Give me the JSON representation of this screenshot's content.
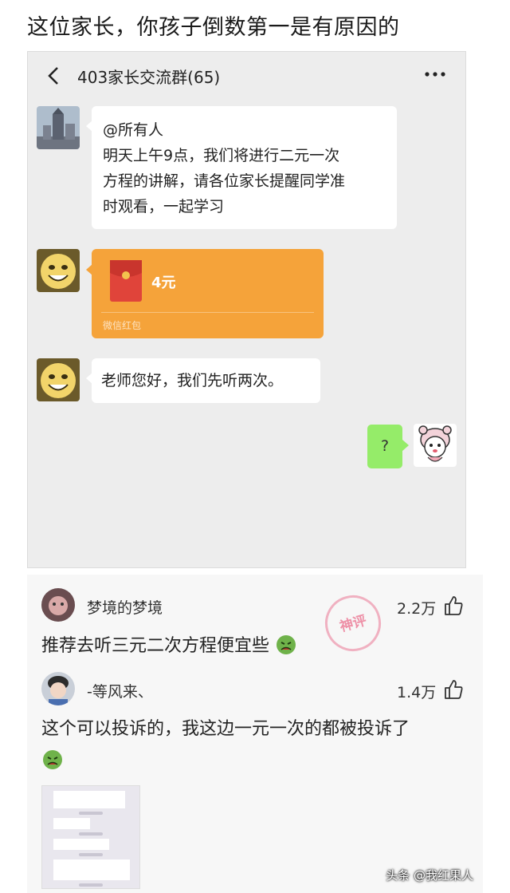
{
  "headline": "这位家长，你孩子倒数第一是有原因的",
  "chat": {
    "title": "403家长交流群(65)",
    "messages": [
      {
        "type": "text",
        "lines": [
          "@所有人",
          "明天上午9点，我们将进行二元一次",
          "方程的讲解，请各位家长提醒同学准",
          "时观看，一起学习"
        ]
      },
      {
        "type": "red_packet",
        "amount": "4元",
        "label": "微信红包"
      },
      {
        "type": "text",
        "lines": [
          "老师您好，我们先听两次。"
        ]
      },
      {
        "type": "self_text",
        "text": "?"
      }
    ]
  },
  "comments": [
    {
      "name": "梦境的梦境",
      "likes": "2.2万",
      "text": "推荐去听三元二次方程便宜些",
      "stamp": "神评"
    },
    {
      "name": "-等风来、",
      "likes": "1.4万",
      "text": "这个可以投诉的，我这边一元一次的都被投诉了"
    }
  ],
  "watermark": "头条 @我红果人",
  "colors": {
    "chat_bg": "#ededed",
    "self_bubble": "#95ec69",
    "red_packet": "#f5a33a"
  }
}
